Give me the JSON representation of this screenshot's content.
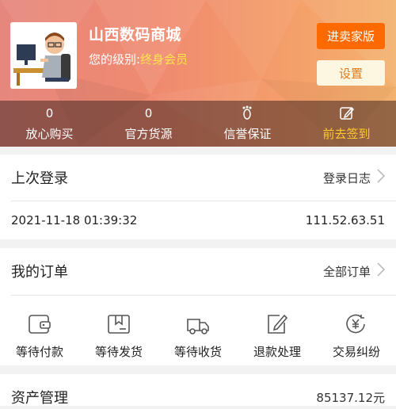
{
  "header": {
    "shop_name": "山西数码商城",
    "level_prefix": "您的级别:",
    "level_value": "终身会员",
    "seller_button": "进卖家版",
    "settings_button": "设置"
  },
  "stats": [
    {
      "value": "0",
      "label": "放心购买"
    },
    {
      "value": "0",
      "label": "官方货源"
    },
    {
      "icon": "footprint-icon",
      "label": "信誉保证"
    },
    {
      "icon": "edit-icon",
      "label": "前去签到"
    }
  ],
  "last_login": {
    "title": "上次登录",
    "link": "登录日志",
    "datetime": "2021-11-18 01:39:32",
    "ip": "111.52.63.51"
  },
  "orders": {
    "title": "我的订单",
    "link": "全部订单",
    "items": [
      {
        "icon": "wallet-icon",
        "label": "等待付款"
      },
      {
        "icon": "package-icon",
        "label": "等待发货"
      },
      {
        "icon": "truck-icon",
        "label": "等待收货"
      },
      {
        "icon": "refund-edit-icon",
        "label": "退款处理"
      },
      {
        "icon": "yuan-dispute-icon",
        "label": "交易纠纷"
      }
    ]
  },
  "funds": {
    "title": "资产管理",
    "value": "85137.12元"
  },
  "colors": {
    "accent_orange": "#ff6a00",
    "highlight_yellow": "#ffe34d",
    "checkin_yellow": "#ffc92e"
  }
}
